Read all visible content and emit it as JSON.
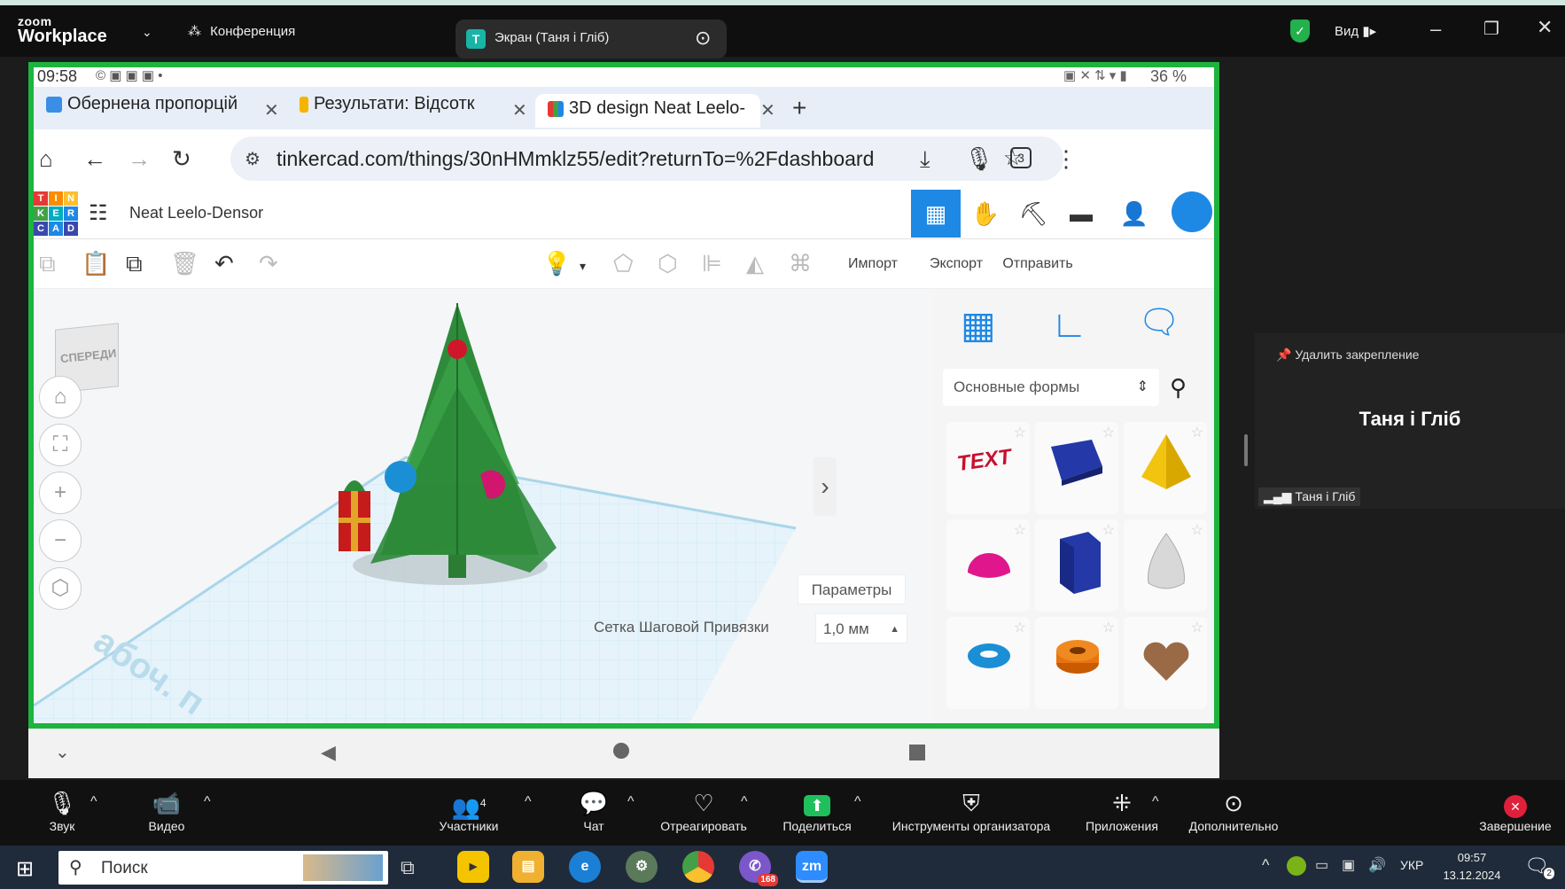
{
  "zoom": {
    "logo_top": "zoom",
    "logo_bottom": "Workplace",
    "meeting_label": "Конференция",
    "share_initial": "T",
    "share_title": "Экран (Таня і Гліб)",
    "view_label": "Вид"
  },
  "phone": {
    "time": "09:58",
    "battery": "36 %"
  },
  "browser": {
    "tabs": [
      {
        "title": "Обернена пропорцій"
      },
      {
        "title": "Результати: Відсотк"
      },
      {
        "title": "3D design Neat Leelo-"
      }
    ],
    "url": "tinkercad.com/things/30nHMmklz55/edit?returnTo=%2Fdashboard",
    "tab_count": "3"
  },
  "tinkercad": {
    "logo_letters": [
      "T",
      "I",
      "N",
      "K",
      "E",
      "R",
      "C",
      "A",
      "D"
    ],
    "project_name": "Neat Leelo-Densor",
    "import_label": "Импорт",
    "export_label": "Экспорт",
    "send_label": "Отправить",
    "viewcube_label": "СПЕРЕДИ",
    "params_label": "Параметры",
    "grid_label": "Сетка Шаговой Привязки",
    "grid_value": "1,0 мм",
    "workplane_text": "абоч. п",
    "shapes_category": "Основные формы",
    "shape_text_label": "TEXT"
  },
  "participant": {
    "unpin_label": "Удалить закрепление",
    "name": "Таня і Гліб",
    "tag": "Таня і Гліб"
  },
  "toolbar": {
    "audio": "Звук",
    "video": "Видео",
    "participants": "Участники",
    "participants_count": "4",
    "chat": "Чат",
    "react": "Отреагировать",
    "share": "Поделиться",
    "host_tools": "Инструменты организатора",
    "apps": "Приложения",
    "more": "Дополнительно",
    "end": "Завершение"
  },
  "taskbar": {
    "search": "Поиск",
    "lang": "УКР",
    "time": "09:57",
    "date": "13.12.2024",
    "viber_badge": "168",
    "notif_badge": "2",
    "zoom_app": "zm"
  },
  "colors": {
    "share_green": "#1db33f",
    "tinker_blue": "#1e88e5",
    "zoom_share": "#1fbf5c",
    "end_red": "#e0203a"
  }
}
